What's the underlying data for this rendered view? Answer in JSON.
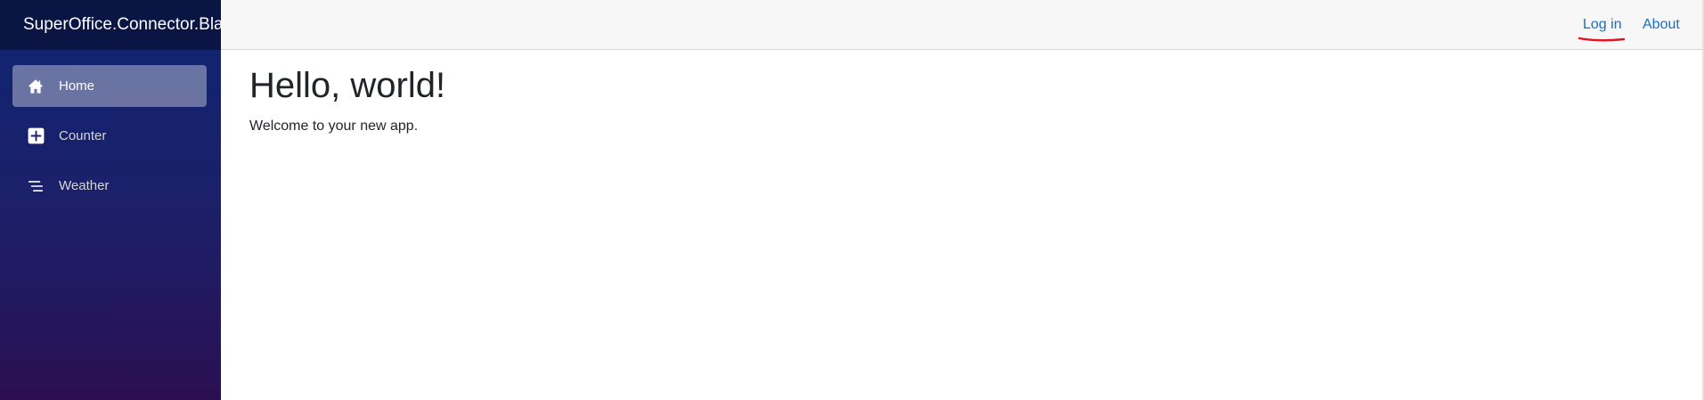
{
  "brand": {
    "title": "SuperOffice.Connector.Blazor"
  },
  "sidebar": {
    "items": [
      {
        "label": "Home",
        "icon": "house-icon",
        "active": true
      },
      {
        "label": "Counter",
        "icon": "plus-square-icon",
        "active": false
      },
      {
        "label": "Weather",
        "icon": "list-icon",
        "active": false
      }
    ]
  },
  "topbar": {
    "login_label": "Log in",
    "about_label": "About"
  },
  "main": {
    "heading": "Hello, world!",
    "text": "Welcome to your new app."
  },
  "colors": {
    "link": "#1b6ec2",
    "sidebar_top": "#0f2572",
    "sidebar_bottom": "#2b0f52",
    "annotation": "#e3131f"
  }
}
